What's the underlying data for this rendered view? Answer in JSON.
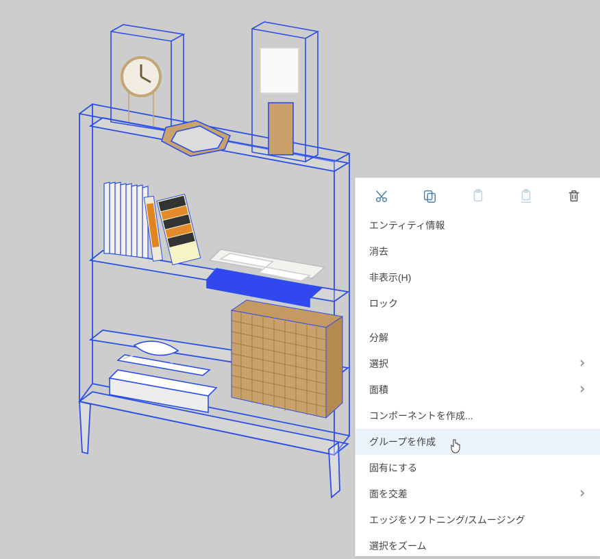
{
  "context_menu": {
    "icons": {
      "cut": "cut-icon",
      "copy": "copy-icon",
      "paste": "paste-icon",
      "paste_in_place": "paste-in-place-icon",
      "trash": "trash-icon"
    },
    "items": {
      "entity_info": "エンティティ情報",
      "erase": "消去",
      "hide": "非表示(H)",
      "lock": "ロック",
      "explode": "分解",
      "select": "選択",
      "area": "面積",
      "make_component": "コンポーネントを作成...",
      "make_group": "グループを作成",
      "make_unique": "固有にする",
      "intersect_faces": "面を交差",
      "soften_smooth_edges": "エッジをソフトニング/スムージング",
      "zoom_selection": "選択をズーム"
    }
  }
}
